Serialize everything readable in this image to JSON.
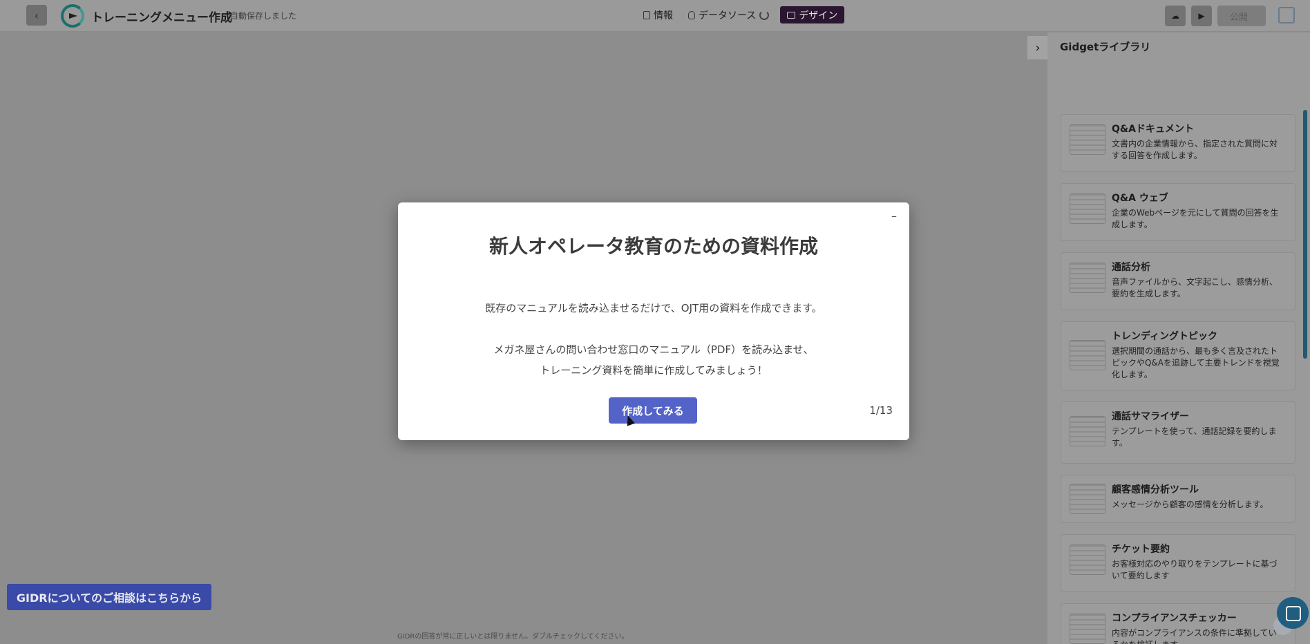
{
  "header": {
    "back_icon": "‹",
    "title": "トレーニングメニュー作成",
    "autosave": "自動保存しました",
    "tabs": [
      {
        "label": "情報"
      },
      {
        "label": "データソース"
      },
      {
        "label": "デザイン"
      }
    ],
    "publish_label": "公開"
  },
  "sidebar": {
    "title": "Gidgetライブラリ",
    "collapse_icon": "›",
    "items": [
      {
        "title": "Q&Aドキュメント",
        "desc": "文書内の企業情報から、指定された質問に対する回答を作成します。"
      },
      {
        "title": "Q&A ウェブ",
        "desc": "企業のWebページを元にして質問の回答を生成します。"
      },
      {
        "title": "通話分析",
        "desc": "音声ファイルから、文字起こし、感情分析、要約を生成します。"
      },
      {
        "title": "トレンディングトピック",
        "desc": "選択期間の通話から、最も多く言及されたトピックやQ&Aを追跡して主要トレンドを視覚化します。"
      },
      {
        "title": "通話サマライザー",
        "desc": "テンプレートを使って、通話記録を要約します。"
      },
      {
        "title": "顧客感情分析ツール",
        "desc": "メッセージから顧客の感情を分析します。"
      },
      {
        "title": "チケット要約",
        "desc": "お客様対応のやり取りをテンプレートに基づいて要約します"
      },
      {
        "title": "コンプライアンスチェッカー",
        "desc": "内容がコンプライアンスの条件に準拠しているかを検証します。"
      }
    ]
  },
  "modal": {
    "title": "新人オペレータ教育のための資料作成",
    "line1": "既存のマニュアルを読み込ませるだけで、OJT用の資料を作成できます。",
    "line2": "メガネ屋さんの問い合わせ窓口のマニュアル（PDF）を読み込ませ、",
    "line3": "トレーニング資料を簡単に作成してみましょう！",
    "cta": "作成してみる",
    "pager": "1/13",
    "close": "–"
  },
  "consult_button": "GIDRについてのご相談はこちらから",
  "disclaimer": "GIDRの回答が常に正しいとは限りません。ダブルチェックしてください。"
}
